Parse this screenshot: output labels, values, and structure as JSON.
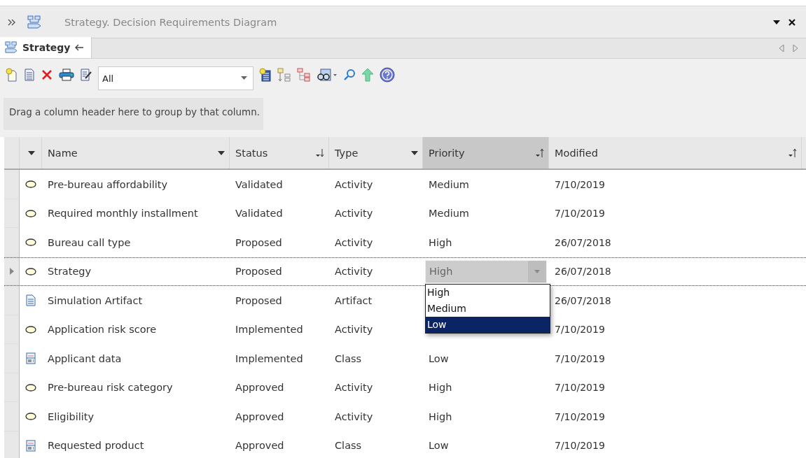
{
  "window": {
    "title": "Strategy.  Decision Requirements Diagram"
  },
  "tabs": [
    {
      "label": "Strategy",
      "selected": true
    }
  ],
  "toolbar": {
    "filter": {
      "value": "All"
    }
  },
  "group_hint": "Drag a column header here to group by that column.",
  "columns": [
    {
      "label": "Name",
      "filter": true,
      "sorted": false,
      "selected": false
    },
    {
      "label": "Status",
      "filter": false,
      "sorted": true,
      "descending": true,
      "selected": false
    },
    {
      "label": "Type",
      "filter": true,
      "sorted": false,
      "selected": false
    },
    {
      "label": "Priority",
      "filter": false,
      "sorted": true,
      "descending": false,
      "selected": true
    },
    {
      "label": "Modified",
      "filter": false,
      "sorted": true,
      "descending": false,
      "selected": false
    }
  ],
  "rows": [
    {
      "kind": "activity",
      "name": "Pre-bureau affordability",
      "status": "Validated",
      "type": "Activity",
      "priority": "Medium",
      "modified": "7/10/2019",
      "selected": false
    },
    {
      "kind": "activity",
      "name": "Required monthly installment",
      "status": "Validated",
      "type": "Activity",
      "priority": "Medium",
      "modified": "7/10/2019",
      "selected": false
    },
    {
      "kind": "activity",
      "name": "Bureau call type",
      "status": "Proposed",
      "type": "Activity",
      "priority": "High",
      "modified": "26/07/2018",
      "selected": false
    },
    {
      "kind": "activity",
      "name": "Strategy",
      "status": "Proposed",
      "type": "Activity",
      "priority": "High",
      "modified": "26/07/2018",
      "selected": true,
      "editing": {
        "options": [
          {
            "label": "High",
            "selected": false
          },
          {
            "label": "Medium",
            "selected": false
          },
          {
            "label": "Low",
            "selected": true
          }
        ]
      }
    },
    {
      "kind": "artifact",
      "name": "Simulation Artifact",
      "status": "Proposed",
      "type": "Artifact",
      "modified": "26/07/2018",
      "selected": false
    },
    {
      "kind": "activity",
      "name": "Application risk score",
      "status": "Implemented",
      "type": "Activity",
      "modified": "7/10/2019",
      "selected": false
    },
    {
      "kind": "class",
      "name": "Applicant data",
      "status": "Implemented",
      "type": "Class",
      "priority": "Low",
      "modified": "7/10/2019",
      "selected": false
    },
    {
      "kind": "activity",
      "name": "Pre-bureau risk category",
      "status": "Approved",
      "type": "Activity",
      "priority": "High",
      "modified": "7/10/2019",
      "selected": false
    },
    {
      "kind": "activity",
      "name": "Eligibility",
      "status": "Approved",
      "type": "Activity",
      "priority": "High",
      "modified": "7/10/2019",
      "selected": false
    },
    {
      "kind": "class",
      "name": "Requested product",
      "status": "Approved",
      "type": "Class",
      "priority": "Low",
      "modified": "7/10/2019",
      "selected": false
    }
  ]
}
